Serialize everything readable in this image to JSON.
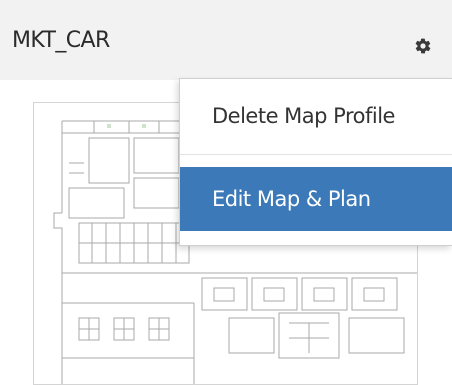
{
  "card": {
    "title": "MKT_CAR"
  },
  "icons": {
    "settings": "gear-icon"
  },
  "menu": {
    "delete_label": "Delete Map Profile",
    "edit_label": "Edit Map & Plan"
  },
  "colors": {
    "header_bg": "#f2f2f2",
    "menu_active_bg": "#3c79b8",
    "menu_active_text": "#ffffff"
  }
}
